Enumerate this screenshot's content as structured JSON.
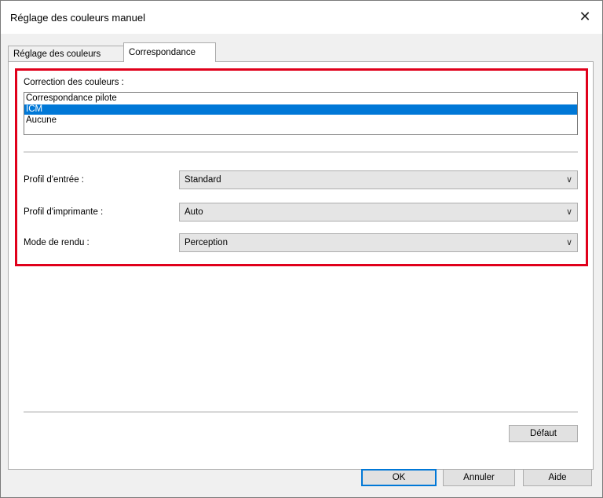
{
  "window": {
    "title": "Réglage des couleurs manuel"
  },
  "tabs": [
    {
      "label": "Réglage des couleurs",
      "active": false
    },
    {
      "label": "Correspondance",
      "active": true
    }
  ],
  "color_correction": {
    "label": "Correction des couleurs :",
    "options": [
      "Correspondance pilote",
      "ICM",
      "Aucune"
    ],
    "selected": "ICM"
  },
  "input_profile": {
    "label": "Profil d'entrée :",
    "value": "Standard"
  },
  "printer_profile": {
    "label": "Profil d'imprimante :",
    "value": "Auto"
  },
  "rendering_mode": {
    "label": "Mode de rendu :",
    "value": "Perception"
  },
  "buttons": {
    "default": "Défaut",
    "ok": "OK",
    "cancel": "Annuler",
    "help": "Aide"
  },
  "colors": {
    "highlight": "#e0001b",
    "selection": "#0078d7"
  }
}
